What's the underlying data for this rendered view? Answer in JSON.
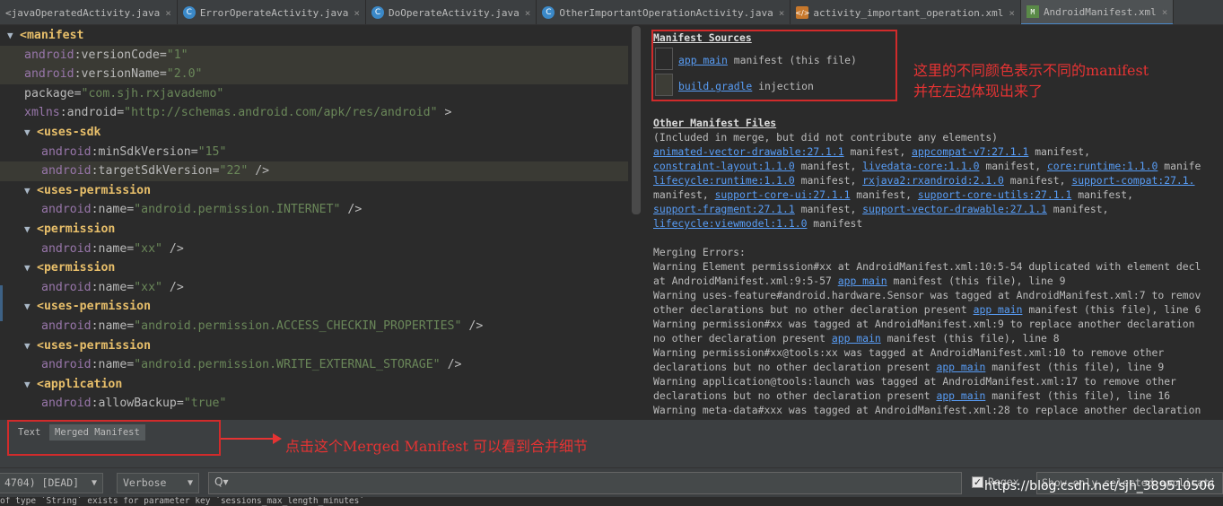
{
  "tabs": [
    {
      "icon": "c-class-icon",
      "label": "<javaOperatedActivity.java",
      "close": "×"
    },
    {
      "icon": "c-class-icon",
      "label": "ErrorOperateActivity.java",
      "close": "×"
    },
    {
      "icon": "c-class-icon",
      "label": "DoOperateActivity.java",
      "close": "×"
    },
    {
      "icon": "c-class-icon",
      "label": "OtherImportantOperationActivity.java",
      "close": "×"
    },
    {
      "icon": "xml-file-icon",
      "label": "activity_important_operation.xml",
      "close": "×"
    },
    {
      "icon": "android-manifest-icon",
      "label": "AndroidManifest.xml",
      "close": "×"
    }
  ],
  "editor": {
    "lines": [
      "<manifest",
      "android:versionCode=\"1\"",
      "android:versionName=\"2.0\"",
      "package=\"com.sjh.rxjavademo\"",
      "xmlns:android=\"http://schemas.android.com/apk/res/android\" >",
      "<uses-sdk",
      "android:minSdkVersion=\"15\"",
      "android:targetSdkVersion=\"22\" />",
      "<uses-permission",
      "android:name=\"android.permission.INTERNET\" />",
      "<permission",
      "android:name=\"xx\" />",
      "<permission",
      "android:name=\"xx\" />",
      "<uses-permission",
      "android:name=\"android.permission.ACCESS_CHECKIN_PROPERTIES\" />",
      "<uses-permission",
      "android:name=\"android.permission.WRITE_EXTERNAL_STORAGE\" />",
      "<application",
      "android:allowBackup=\"true\""
    ]
  },
  "merged": {
    "sources_header": "Manifest Sources",
    "source1_link": "app main",
    "source1_text": " manifest (this file)",
    "source2_link": "build.gradle",
    "source2_text": " injection",
    "swatch1_color": "#2b2b2b",
    "swatch2_color": "#3d3d36",
    "other_header": "Other Manifest Files",
    "other_note": "(Included in merge, but did not contribute any elements)",
    "deps_lines": [
      [
        [
          "animated-vector-drawable:27.1.1",
          true
        ],
        [
          " manifest, ",
          false
        ],
        [
          "appcompat-v7:27.1.1",
          true
        ],
        [
          " manifest,",
          false
        ]
      ],
      [
        [
          "constraint-layout:1.1.0",
          true
        ],
        [
          " manifest, ",
          false
        ],
        [
          "livedata-core:1.1.0",
          true
        ],
        [
          " manifest, ",
          false
        ],
        [
          "core:runtime:1.1.0",
          true
        ],
        [
          " manife",
          false
        ]
      ],
      [
        [
          "lifecycle:runtime:1.1.0",
          true
        ],
        [
          " manifest, ",
          false
        ],
        [
          "rxjava2:rxandroid:2.1.0",
          true
        ],
        [
          " manifest, ",
          false
        ],
        [
          "support-compat:27.1.",
          true
        ]
      ],
      [
        [
          "manifest, ",
          false
        ],
        [
          "support-core-ui:27.1.1",
          true
        ],
        [
          " manifest, ",
          false
        ],
        [
          "support-core-utils:27.1.1",
          true
        ],
        [
          " manifest,",
          false
        ]
      ],
      [
        [
          "support-fragment:27.1.1",
          true
        ],
        [
          " manifest, ",
          false
        ],
        [
          "support-vector-drawable:27.1.1",
          true
        ],
        [
          " manifest,",
          false
        ]
      ],
      [
        [
          "lifecycle:viewmodel:1.1.0",
          true
        ],
        [
          " manifest",
          false
        ]
      ]
    ],
    "errors_header": "Merging Errors:",
    "error_lines": [
      [
        [
          "Warning Element permission#xx at AndroidManifest.xml:10:5-54 duplicated with element decl",
          false
        ]
      ],
      [
        [
          "at AndroidManifest.xml:9:5-57 ",
          false
        ],
        [
          "app main",
          true
        ],
        [
          " manifest (this file), line 9",
          false
        ]
      ],
      [
        [
          "Warning uses-feature#android.hardware.Sensor was tagged at AndroidManifest.xml:7 to remov",
          false
        ]
      ],
      [
        [
          "other declarations but no other declaration present ",
          false
        ],
        [
          "app main",
          true
        ],
        [
          " manifest (this file), line 6",
          false
        ]
      ],
      [
        [
          "Warning permission#xx was tagged at AndroidManifest.xml:9 to replace another declaration",
          false
        ]
      ],
      [
        [
          "no other declaration present ",
          false
        ],
        [
          "app main",
          true
        ],
        [
          " manifest (this file), line 8",
          false
        ]
      ],
      [
        [
          "Warning permission#xx@tools:xx was tagged at AndroidManifest.xml:10 to remove other",
          false
        ]
      ],
      [
        [
          "declarations but no other declaration present ",
          false
        ],
        [
          "app main",
          true
        ],
        [
          " manifest (this file), line 9",
          false
        ]
      ],
      [
        [
          "Warning application@tools:launch was tagged at AndroidManifest.xml:17 to remove other",
          false
        ]
      ],
      [
        [
          "declarations but no other declaration present ",
          false
        ],
        [
          "app main",
          true
        ],
        [
          " manifest (this file), line 16",
          false
        ]
      ],
      [
        [
          "Warning meta-data#xxx was tagged at AndroidManifest.xml:28 to replace another declaration",
          false
        ]
      ]
    ]
  },
  "annotations": {
    "right_line1": "这里的不同颜色表示不同的manifest",
    "right_line2": "并在左边体现出来了",
    "bottom": "点击这个Merged Manifest 可以看到合并细节",
    "color": "#e53333"
  },
  "bottom_tabs": {
    "text_tab": "Text",
    "merged_tab": "Merged Manifest"
  },
  "toolbar": {
    "process": "4704) [DEAD]",
    "level": "Verbose",
    "search_icon": "Q▾",
    "regex_checked": "✓",
    "regex_label": "Regex",
    "selected_only": "Show only selected applicati"
  },
  "log_line": "of type `String` exists for parameter key `sessions_max_length_minutes`",
  "watermark": "https://blog.csdn.net/sjh_389510506"
}
